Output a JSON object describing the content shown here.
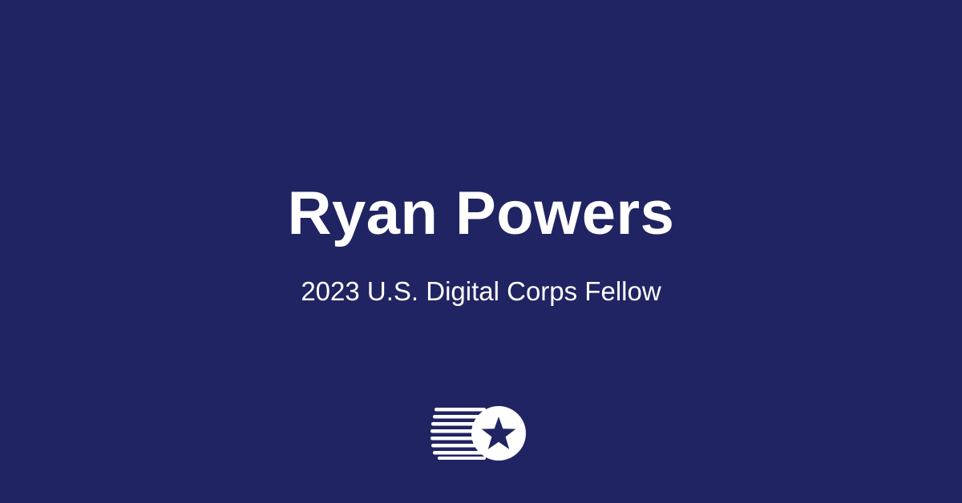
{
  "card": {
    "name": "Ryan Powers",
    "subtitle": "2023 U.S. Digital Corps Fellow",
    "logo_icon": "us-digital-corps-star-logo-icon"
  },
  "colors": {
    "background": "#212462",
    "text": "#ffffff"
  }
}
